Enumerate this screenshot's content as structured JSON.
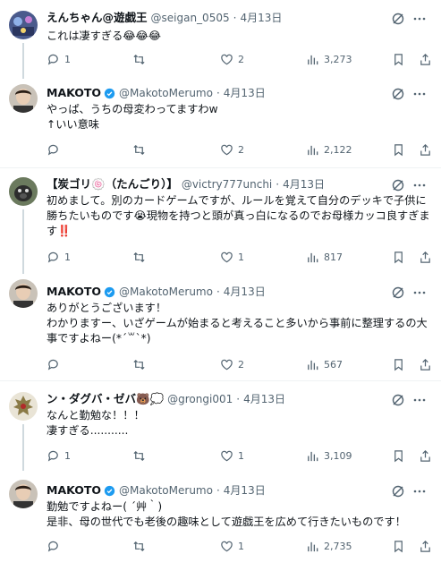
{
  "tweets": [
    {
      "name": "えんちゃん@遊戯王",
      "handle": "@seigan_0505",
      "date": "4月13日",
      "text": "これは凄すぎる😂😂😂",
      "replies": "1",
      "retweets": "",
      "likes": "2",
      "views": "3,273",
      "verified": false
    },
    {
      "name": "MAKOTO",
      "handle": "@MakotoMerumo",
      "date": "4月13日",
      "text": "やっぱ、うちの母変わってますわw\n↑いい意味",
      "replies": "",
      "retweets": "",
      "likes": "2",
      "views": "2,122",
      "verified": true
    },
    {
      "name": "【炭ゴリ🍥（たんごり）】",
      "handle": "@victry777unchi",
      "date": "4月13日",
      "text": "初めまして。別のカードゲームですが、ルールを覚えて自分のデッキで子供に勝ちたいものです😭現物を持つと頭が真っ白になるのでお母様カッコ良すぎます‼️",
      "replies": "1",
      "retweets": "",
      "likes": "1",
      "views": "817",
      "verified": false
    },
    {
      "name": "MAKOTO",
      "handle": "@MakotoMerumo",
      "date": "4月13日",
      "text": "ありがとうございます！\nわかりますー、いざゲームが始まると考えること多いから事前に整理するの大事ですよねー(*´꒳`*)",
      "replies": "",
      "retweets": "",
      "likes": "2",
      "views": "567",
      "verified": true
    },
    {
      "name": "ン・ダグバ・ゼバ🐻💭",
      "handle": "@grongi001",
      "date": "4月13日",
      "text": "なんと勤勉な！！！\n凄すぎる...........",
      "replies": "1",
      "retweets": "",
      "likes": "1",
      "views": "3,109",
      "verified": false
    },
    {
      "name": "MAKOTO",
      "handle": "@MakotoMerumo",
      "date": "4月13日",
      "text": "勤勉ですよねー( ´艸｀)\n是非、母の世代でも老後の趣味として遊戯王を広めて行きたいものです！",
      "replies": "",
      "retweets": "",
      "likes": "1",
      "views": "2,735",
      "verified": true
    }
  ],
  "separator": "·",
  "icons": {
    "reply": "reply-icon",
    "retweet": "retweet-icon",
    "like": "heart-icon",
    "views": "views-icon",
    "bookmark": "bookmark-icon",
    "share": "share-icon",
    "grok": "grok-icon",
    "verified": "verified-badge-icon"
  },
  "colors": {
    "verified": "#1d9bf0",
    "secondary_text": "#536471",
    "divider": "#eff3f4"
  }
}
